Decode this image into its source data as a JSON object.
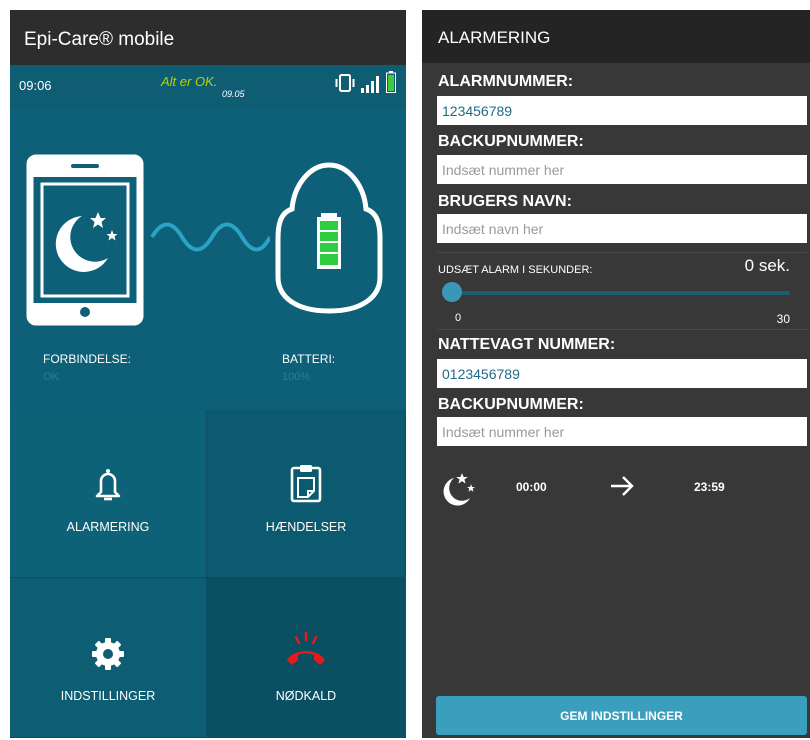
{
  "left_screen": {
    "app_title": "Epi-Care® mobile",
    "status_bar": {
      "time": "09:06",
      "status_text": "Alt er OK.",
      "status_time": "09.05",
      "icons": [
        "vibrate-icon",
        "signal-icon",
        "battery-icon"
      ],
      "status_color": "#b5d400"
    },
    "connection": {
      "label": "FORBINDELSE:",
      "value": "OK"
    },
    "battery": {
      "label": "BATTERI:",
      "value": "100%",
      "level": 1.0
    },
    "tiles": [
      {
        "icon": "bell-icon",
        "label": "ALARMERING"
      },
      {
        "icon": "clipboard-icon",
        "label": "HÆNDELSER"
      },
      {
        "icon": "gear-icon",
        "label": "INDSTILLINGER"
      },
      {
        "icon": "phone-hangup-icon",
        "label": "NØDKALD",
        "icon_color": "#e21b1b"
      }
    ]
  },
  "right_screen": {
    "title": "ALARMERING",
    "alarm_number": {
      "label": "ALARMNUMMER:",
      "value": "123456789"
    },
    "backup_number": {
      "label": "BACKUPNUMMER:",
      "placeholder": "Indsæt nummer her"
    },
    "user_name": {
      "label": "BRUGERS NAVN:",
      "placeholder": "Indsæt navn her"
    },
    "alarm_delay": {
      "label": "UDSÆT ALARM I SEKUNDER:",
      "value_text": "0 sek.",
      "min": "0",
      "max": "30",
      "value": 0
    },
    "night_number": {
      "label": "NATTEVAGT NUMMER:",
      "value": "0123456789"
    },
    "night_backup_number": {
      "label": "BACKUPNUMMER:",
      "placeholder": "Indsæt nummer her"
    },
    "night_schedule": {
      "icon": "moon-stars-icon",
      "from": "00:00",
      "arrow": "arrow-right-icon",
      "to": "23:59"
    },
    "save_label": "GEM INDSTILLINGER",
    "accent_color": "#3a9fbd"
  }
}
